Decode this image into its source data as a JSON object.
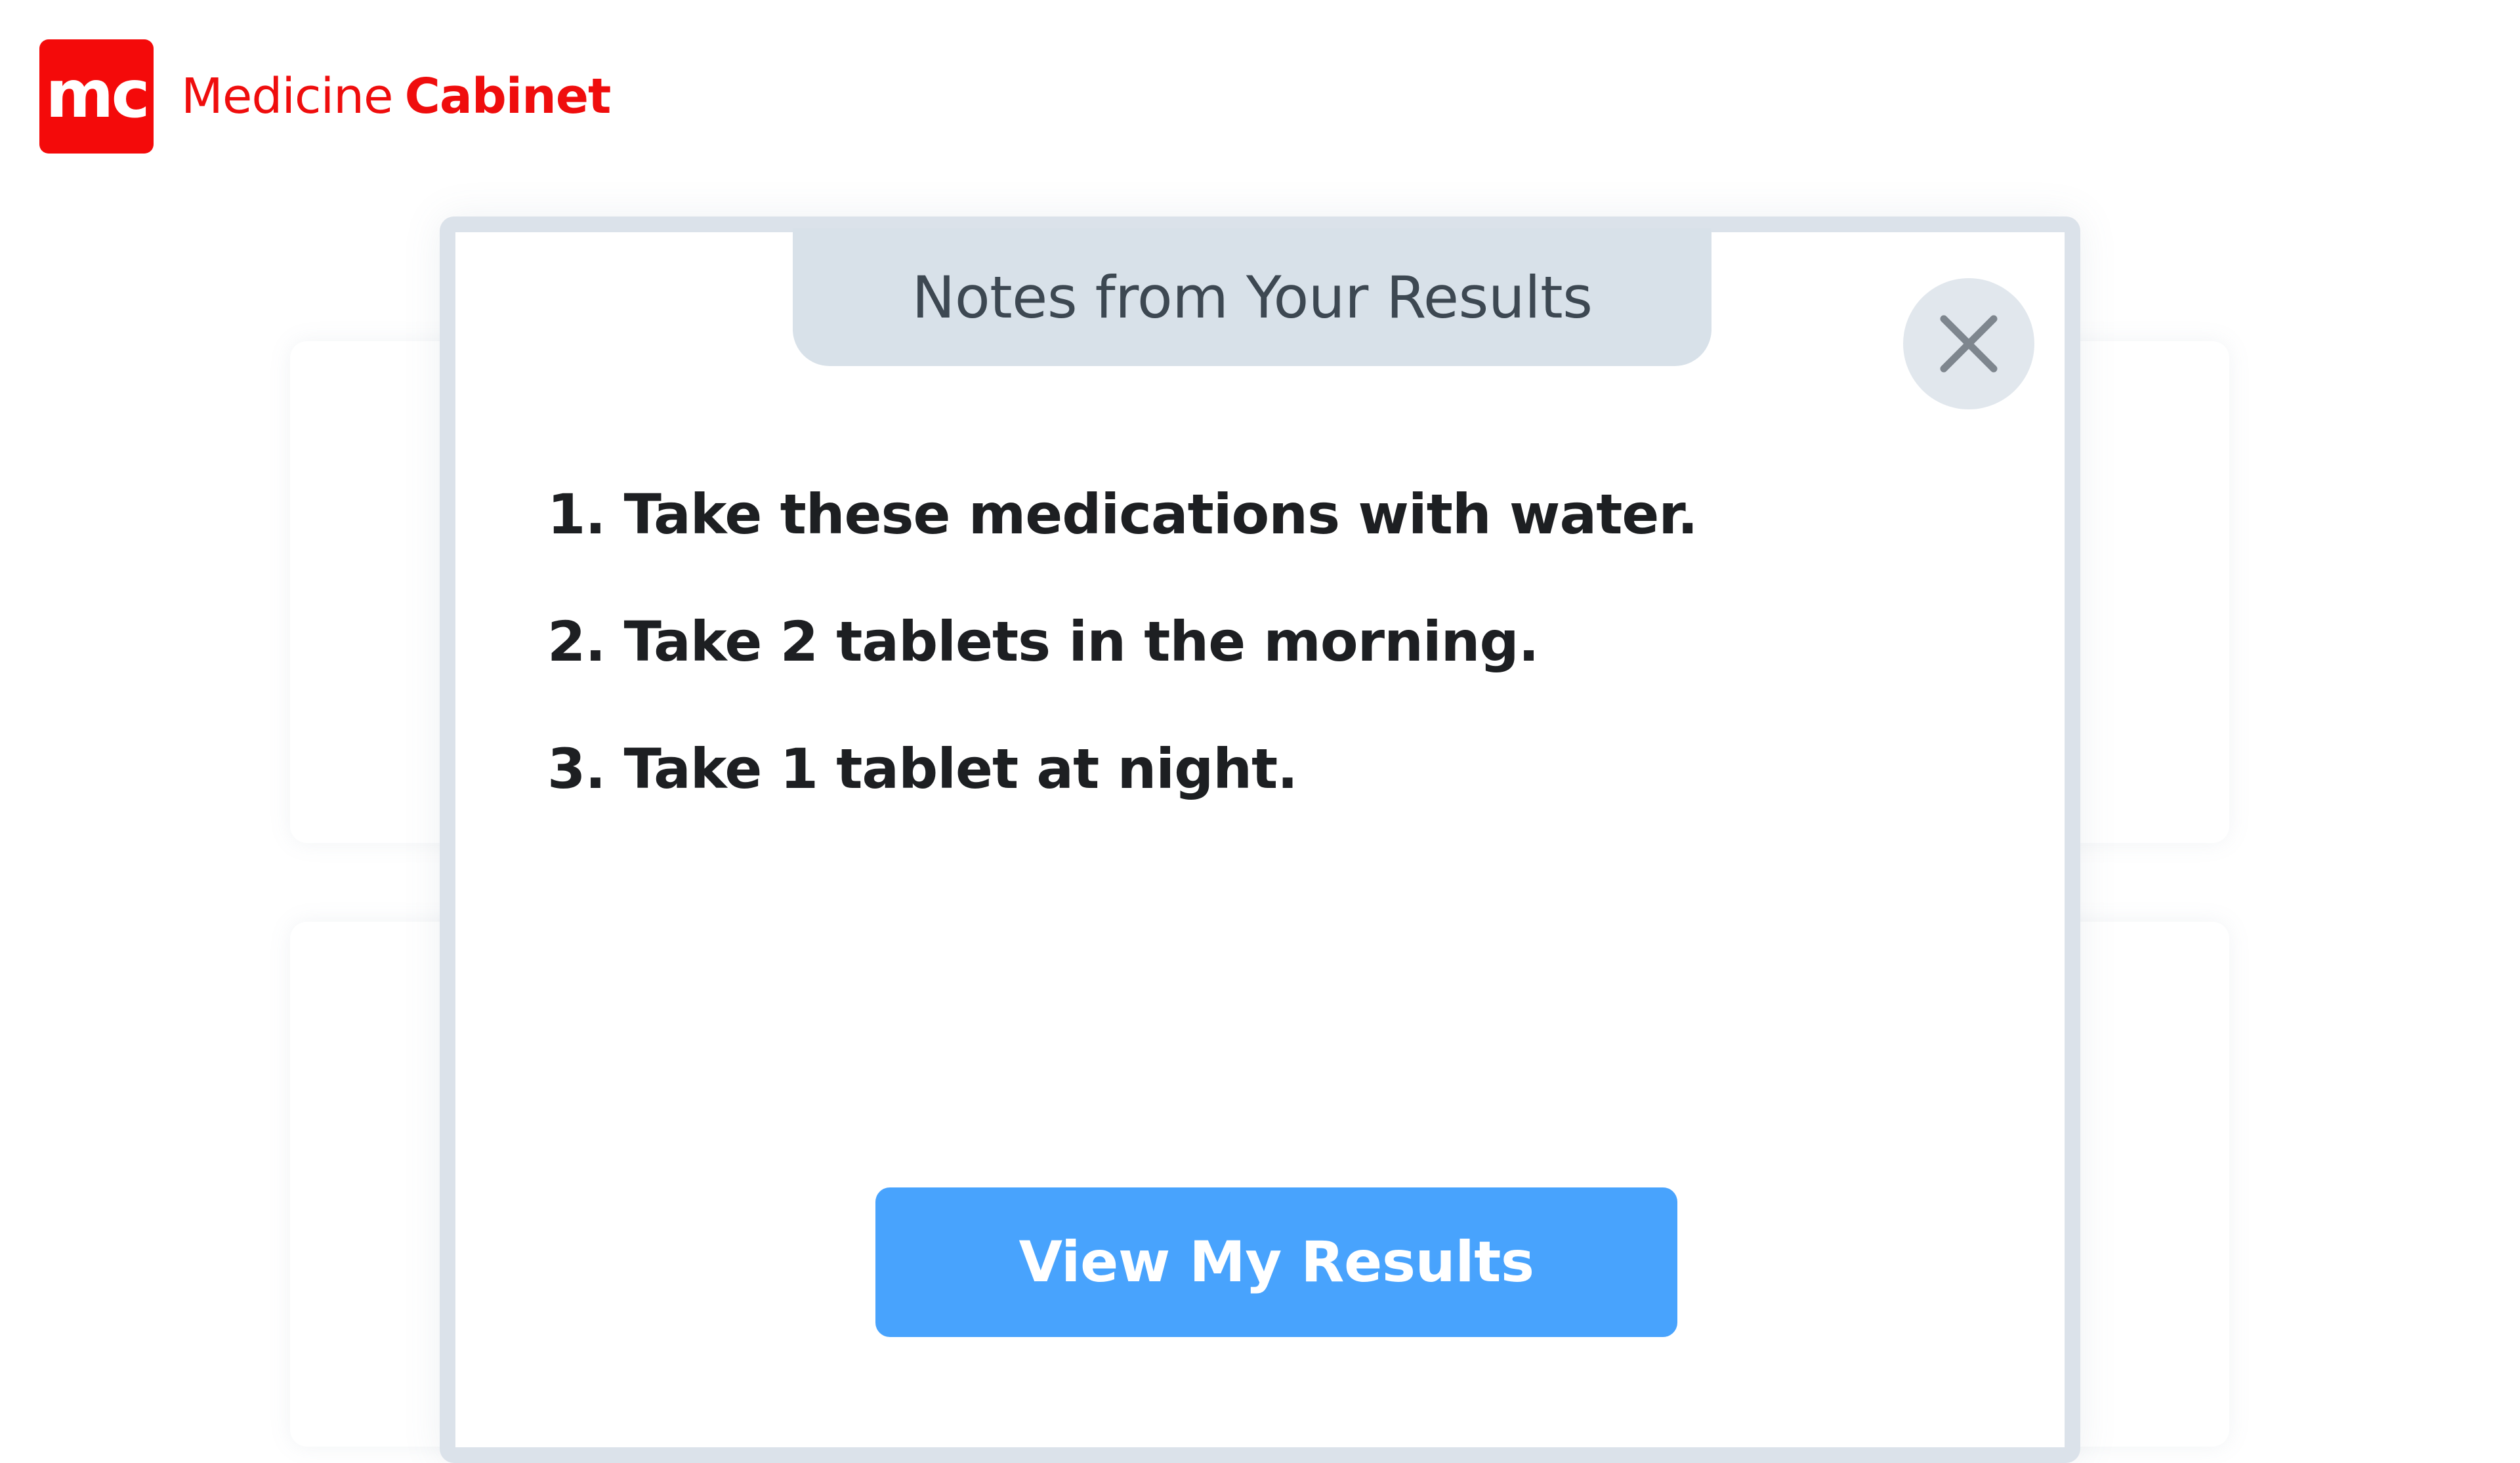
{
  "brand": {
    "logo_text": "mc",
    "name_light": "Medicine",
    "name_bold": "Cabinet",
    "color": "#f40a0a"
  },
  "modal": {
    "title": "Notes from Your Results",
    "close_icon": "close-icon",
    "notes": [
      "1. Take these medications with water.",
      "2. Take 2 tablets in the morning.",
      "3. Take 1 tablet at night."
    ],
    "primary_button_label": "View My Results",
    "accent_color": "#48a3fd"
  }
}
